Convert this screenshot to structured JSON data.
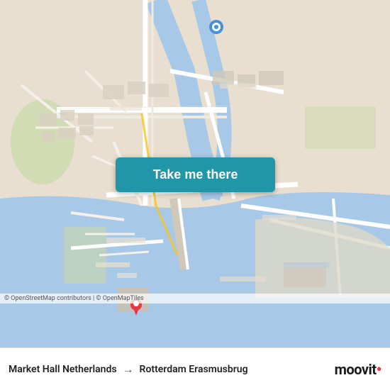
{
  "map": {
    "attribution": "© OpenStreetMap contributors | © OpenMapTiles",
    "center_lat": 51.918,
    "center_lng": 4.481
  },
  "button": {
    "label": "Take me there"
  },
  "route": {
    "origin": "Market Hall Netherlands",
    "destination": "Rotterdam Erasmusbrug",
    "arrow": "→"
  },
  "branding": {
    "name": "moovit",
    "dot_color": "#e63946"
  },
  "colors": {
    "water": "#a8c8e8",
    "road_major": "#ffffff",
    "road_minor": "#f5f0e8",
    "land": "#e8e0d8",
    "green": "#c8d8b0",
    "button_bg": "#2196a8",
    "button_text": "#ffffff",
    "pin_origin": "#e63946",
    "pin_dest": "#4a90d9"
  }
}
